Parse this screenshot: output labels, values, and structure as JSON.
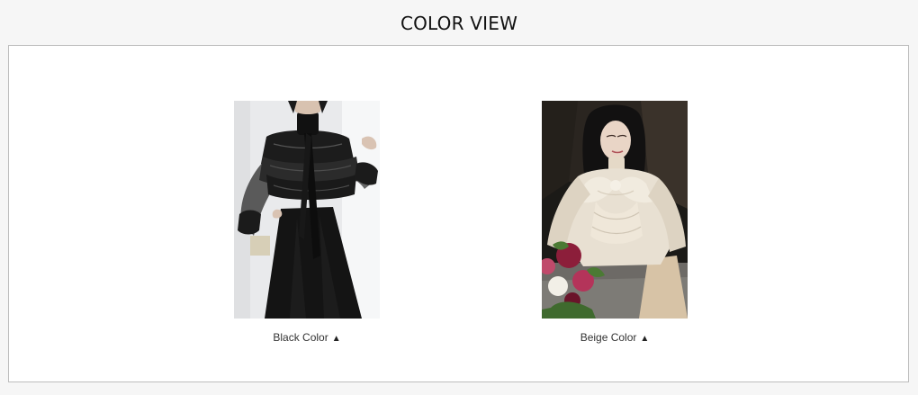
{
  "section": {
    "title": "COLOR VIEW"
  },
  "items": [
    {
      "label": "Black Color",
      "arrow": "▲",
      "swatch": "#1a1a1a"
    },
    {
      "label": "Beige Color",
      "arrow": "▲",
      "swatch": "#e8dcc8"
    }
  ],
  "icons": {
    "expand": "up-triangle-icon"
  }
}
